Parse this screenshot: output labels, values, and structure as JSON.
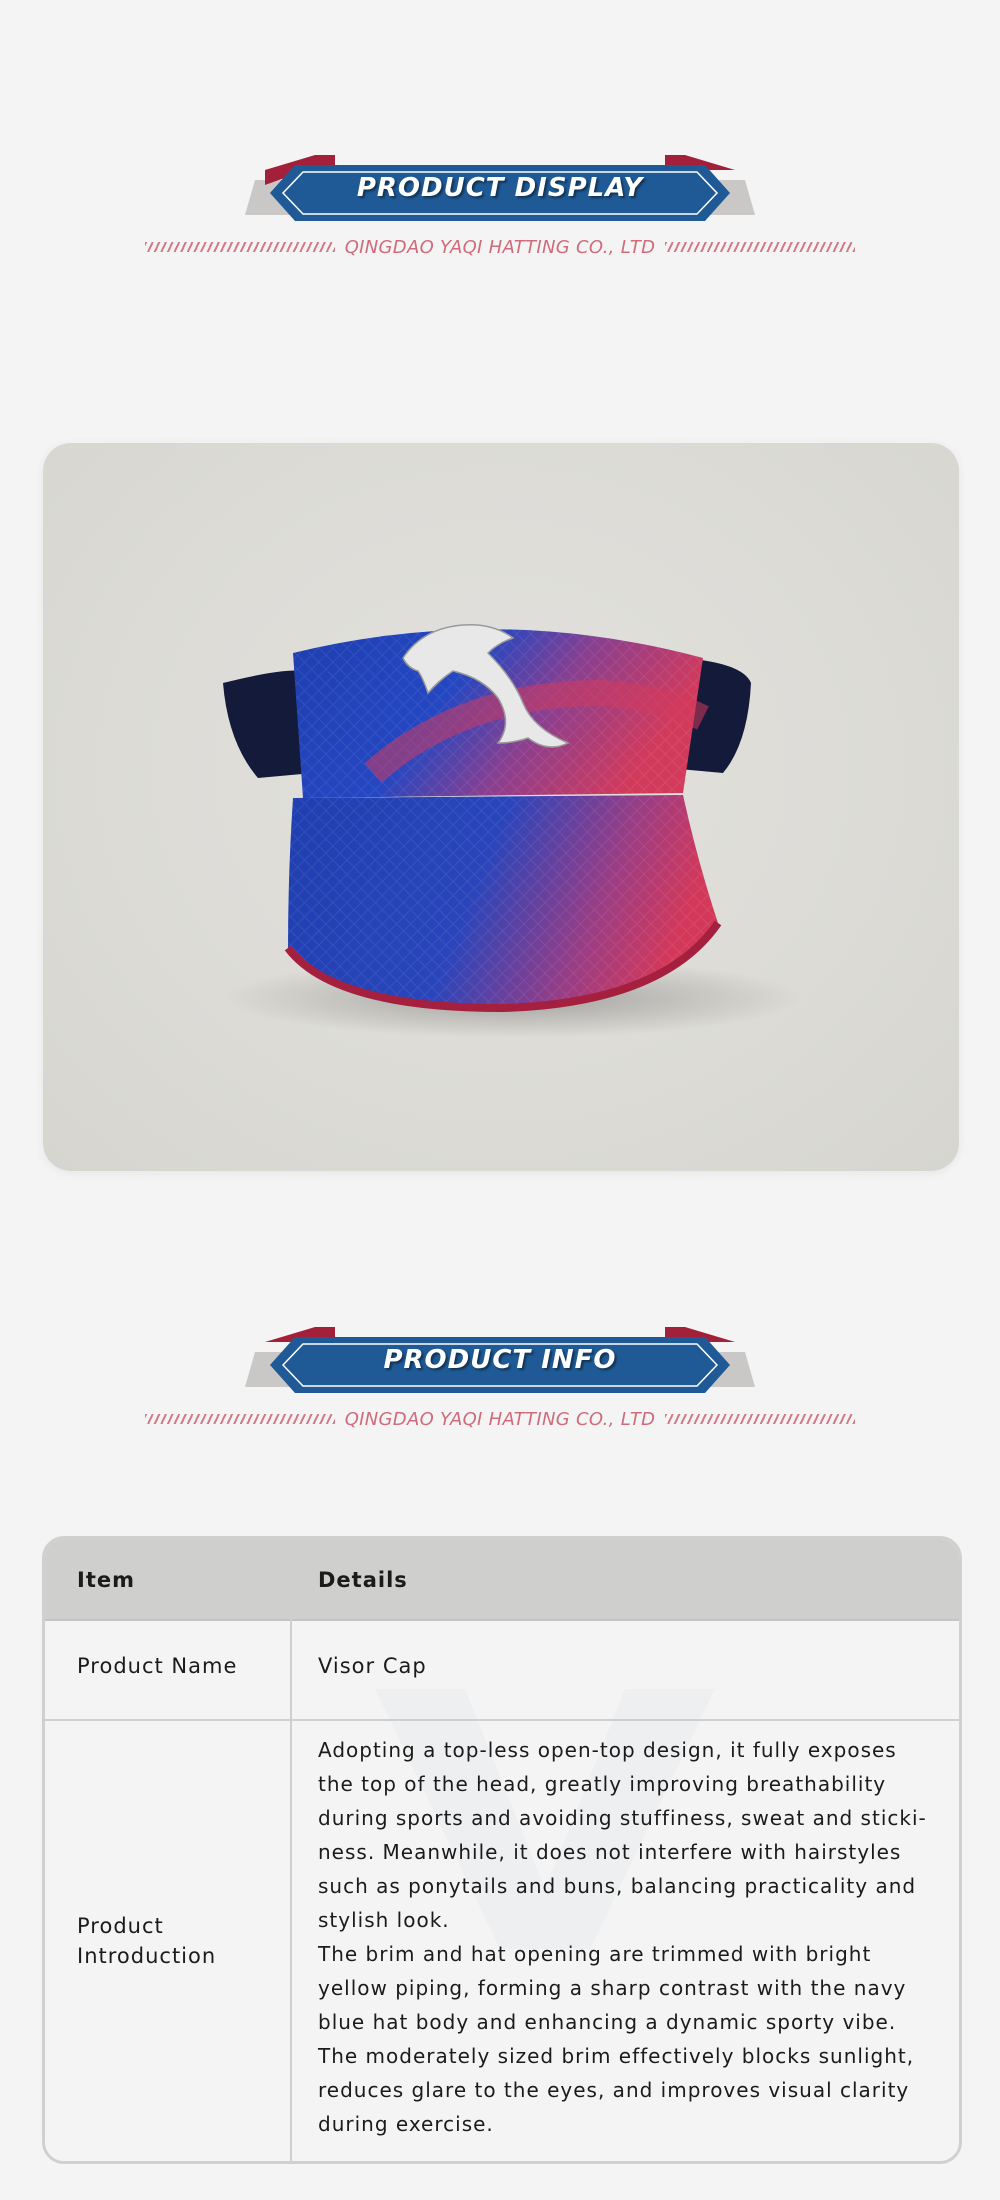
{
  "sections": {
    "display": {
      "title": "PRODUCT DISPLAY",
      "company": "QINGDAO YAQI HATTING CO., LTD"
    },
    "info": {
      "title": "PRODUCT INFO",
      "company": "QINGDAO YAQI HATTING CO., LTD"
    }
  },
  "product_image": {
    "subject": "visor-cap-dolphin-embroidery",
    "colors": {
      "blue": "#1f3fb0",
      "red": "#d23a5c",
      "navy": "#141a3a"
    }
  },
  "table": {
    "header": {
      "item": "Item",
      "details": "Details"
    },
    "rows": [
      {
        "item": "Product Name",
        "details": "Visor Cap"
      },
      {
        "item": "Product Introduction",
        "details_lines": [
          "Adopting a top-less open-top design, it fully exposes",
          "the top of the head, greatly improving breathability",
          "during sports and avoiding stuffiness, sweat and sticki-",
          "ness. Meanwhile, it does not interfere with hairstyles",
          "such as ponytails and buns, balancing practicality and",
          "stylish look.",
          "The brim and hat opening are trimmed with bright",
          "yellow piping, forming a sharp contrast with the navy",
          "blue hat body and enhancing a dynamic sporty vibe.",
          "The moderately sized brim effectively blocks sunlight,",
          "reduces glare to the eyes, and improves visual clarity",
          "during exercise."
        ]
      }
    ]
  },
  "colors": {
    "banner_blue": "#1f5a96",
    "banner_red": "#a3203a",
    "banner_grey": "#c8c8c6",
    "accent_text": "#cf6b7a",
    "background": "#f4f4f4"
  }
}
